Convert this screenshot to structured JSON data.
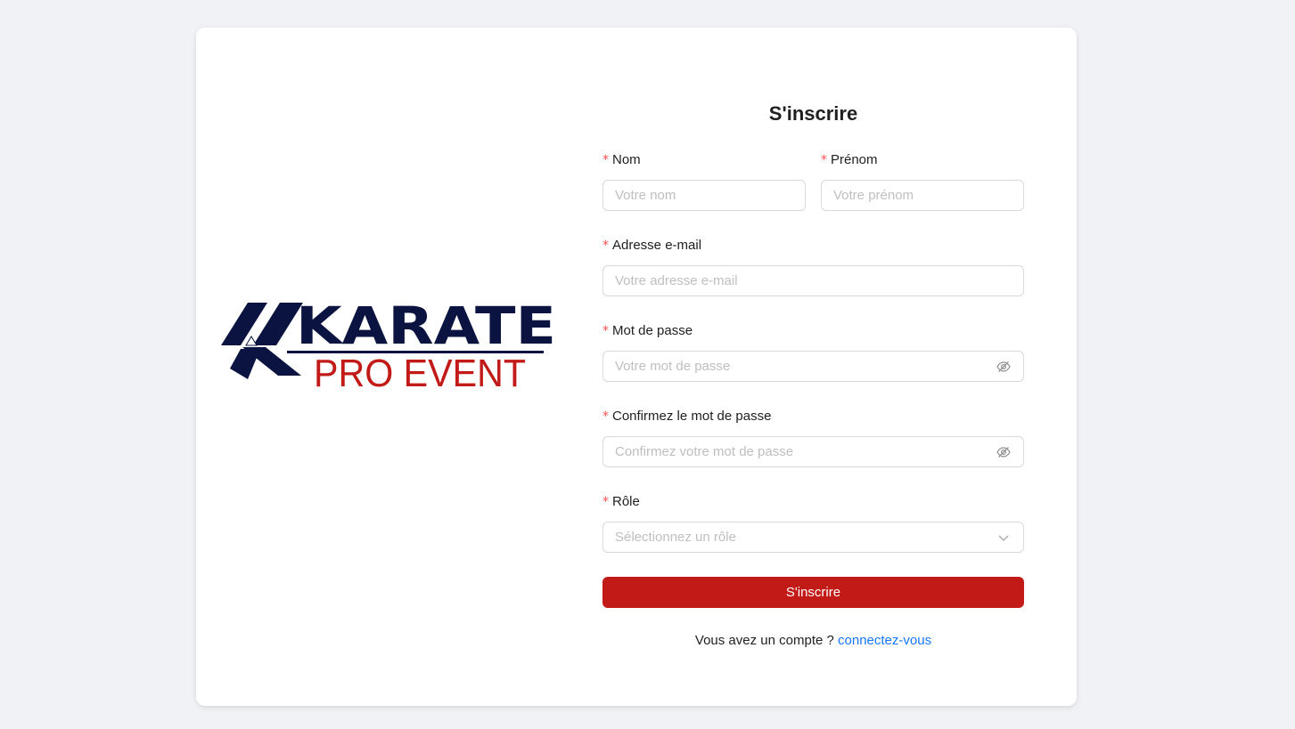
{
  "brand": {
    "logo_top": "KARATE",
    "logo_bottom": "PRO EVENT",
    "primary_color": "#0b1340",
    "accent_color": "#c21a17"
  },
  "form": {
    "title": "S'inscrire",
    "required_mark": "*",
    "nom": {
      "label": "Nom",
      "placeholder": "Votre nom"
    },
    "prenom": {
      "label": "Prénom",
      "placeholder": "Votre prénom"
    },
    "email": {
      "label": "Adresse e-mail",
      "placeholder": "Votre adresse e-mail"
    },
    "password": {
      "label": "Mot de passe",
      "placeholder": "Votre mot de passe",
      "icon": "eye-invisible-icon"
    },
    "confirm_password": {
      "label": "Confirmez le mot de passe",
      "placeholder": "Confirmez votre mot de passe",
      "icon": "eye-invisible-icon"
    },
    "role": {
      "label": "Rôle",
      "placeholder": "Sélectionnez un rôle",
      "icon": "chevron-down-icon"
    },
    "submit_label": "S'inscrire",
    "have_account_text": "Vous avez un compte ?",
    "login_link": "connectez-vous"
  }
}
